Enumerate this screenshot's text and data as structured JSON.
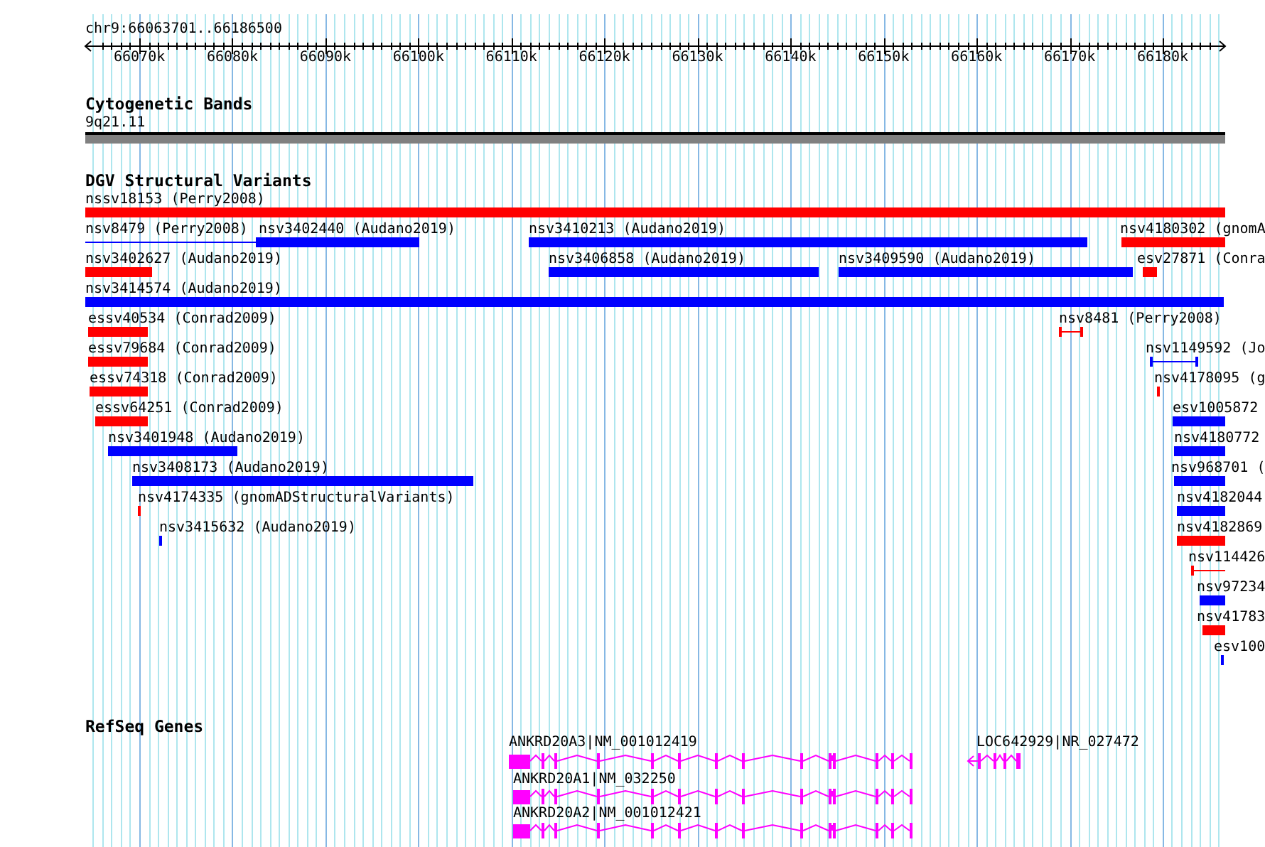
{
  "location": "chr9:66063701..66186500",
  "ruler_ticks": [
    "66070k",
    "66080k",
    "66090k",
    "66100k",
    "66110k",
    "66120k",
    "66130k",
    "66140k",
    "66150k",
    "66160k",
    "66170k",
    "66180k"
  ],
  "tracks": [
    {
      "kind": "bands",
      "title": "Cytogenetic Bands",
      "features": [
        {
          "label": "9q21.11"
        }
      ]
    },
    {
      "kind": "variants",
      "title": "DGV Structural Variants",
      "features": [
        {
          "label": "nssv18153 (Perry2008)",
          "color": "#ff0000",
          "kind": "bar"
        },
        {
          "label": "nsv8479 (Perry2008)",
          "color": "#0000ff",
          "kind": "line"
        },
        {
          "label": "nsv3402440 (Audano2019)",
          "color": "#0000ff",
          "kind": "bar"
        },
        {
          "label": "nsv3410213 (Audano2019)",
          "color": "#0000ff",
          "kind": "bar"
        },
        {
          "label": "nsv4180302 (gnomA",
          "color": "#ff0000",
          "kind": "bar"
        },
        {
          "label": "nsv3402627 (Audano2019)",
          "color": "#ff0000",
          "kind": "bar"
        },
        {
          "label": "nsv3406858 (Audano2019)",
          "color": "#0000ff",
          "kind": "bar"
        },
        {
          "label": "nsv3409590 (Audano2019)",
          "color": "#0000ff",
          "kind": "bar"
        },
        {
          "label": "esv27871 (Conra",
          "color": "#ff0000",
          "kind": "bar"
        },
        {
          "label": "nsv3414574 (Audano2019)",
          "color": "#0000ff",
          "kind": "bar"
        },
        {
          "label": "essv40534 (Conrad2009)",
          "color": "#ff0000",
          "kind": "bar"
        },
        {
          "label": "nsv8481 (Perry2008)",
          "color": "#ff0000",
          "kind": "line"
        },
        {
          "label": "essv79684 (Conrad2009)",
          "color": "#ff0000",
          "kind": "bar"
        },
        {
          "label": "nsv1149592 (Jo",
          "color": "#0000ff",
          "kind": "line"
        },
        {
          "label": "essv74318 (Conrad2009)",
          "color": "#ff0000",
          "kind": "bar"
        },
        {
          "label": "nsv4178095 (g",
          "color": "#ff0000",
          "kind": "bar"
        },
        {
          "label": "essv64251 (Conrad2009)",
          "color": "#ff0000",
          "kind": "bar"
        },
        {
          "label": "esv1005872",
          "color": "#0000ff",
          "kind": "bar"
        },
        {
          "label": "nsv3401948 (Audano2019)",
          "color": "#0000ff",
          "kind": "bar"
        },
        {
          "label": "nsv4180772",
          "color": "#0000ff",
          "kind": "bar"
        },
        {
          "label": "nsv3408173 (Audano2019)",
          "color": "#0000ff",
          "kind": "bar"
        },
        {
          "label": "nsv968701 (",
          "color": "#0000ff",
          "kind": "bar"
        },
        {
          "label": "nsv4174335 (gnomADStructuralVariants)",
          "color": "#ff0000",
          "kind": "bar"
        },
        {
          "label": "nsv4182044",
          "color": "#0000ff",
          "kind": "bar"
        },
        {
          "label": "nsv3415632 (Audano2019)",
          "color": "#0000ff",
          "kind": "bar"
        },
        {
          "label": "nsv4182869",
          "color": "#ff0000",
          "kind": "bar"
        },
        {
          "label": "nsv114426",
          "color": "#ff0000",
          "kind": "line"
        },
        {
          "label": "nsv97234",
          "color": "#0000ff",
          "kind": "bar"
        },
        {
          "label": "nsv41783",
          "color": "#ff0000",
          "kind": "bar"
        },
        {
          "label": "esv100",
          "color": "#0000ff",
          "kind": "bar"
        }
      ]
    },
    {
      "kind": "genes",
      "title": "RefSeq Genes",
      "features": [
        {
          "label": "ANKRD20A3|NM_001012419",
          "kind": "forward"
        },
        {
          "label": "LOC642929|NR_027472",
          "kind": "reverse"
        },
        {
          "label": "ANKRD20A1|NM_032250",
          "kind": "forward"
        },
        {
          "label": "ANKRD20A2|NM_001012421",
          "kind": "forward"
        }
      ]
    }
  ]
}
